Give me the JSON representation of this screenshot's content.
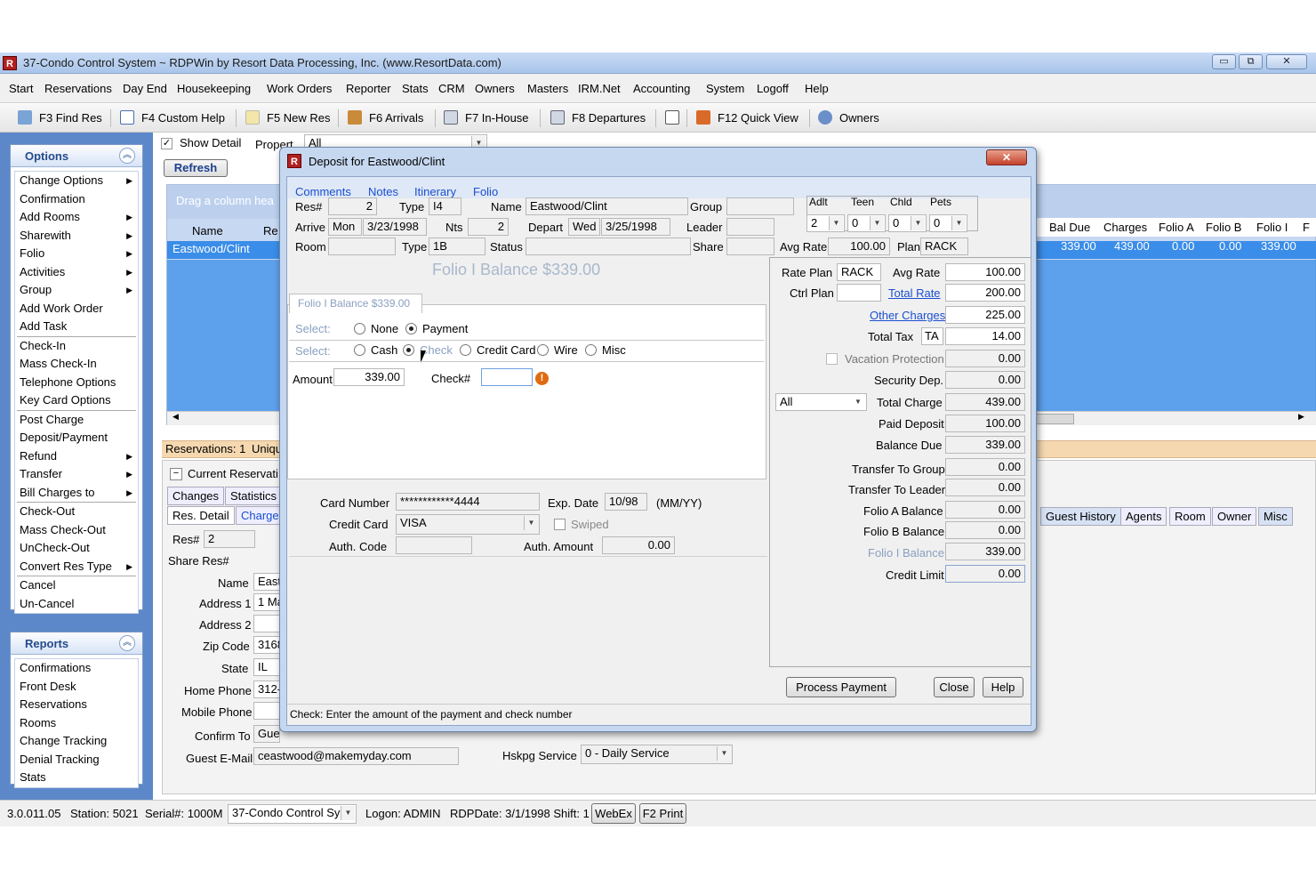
{
  "app": {
    "title": "37-Condo Control System ~ RDPWin by Resort Data Processing, Inc. (www.ResortData.com)",
    "min": "▭",
    "max": "⧉",
    "close": "✕"
  },
  "menu": [
    "Start",
    "Reservations",
    "Day End",
    "Housekeeping",
    "Work Orders",
    "Reporter",
    "Stats",
    "CRM",
    "Owners",
    "Masters",
    "IRM.Net",
    "Accounting",
    "System",
    "Logoff",
    "Help"
  ],
  "toolbar": [
    "F3 Find Res",
    "F4 Custom Help",
    "F5 New Res",
    "F6 Arrivals",
    "F7 In-House",
    "F8 Departures",
    "",
    "F12 Quick View",
    "Owners"
  ],
  "options": {
    "title": "Options",
    "items": [
      "Change Options",
      "Confirmation",
      "Add Rooms",
      "Sharewith",
      "Folio",
      "Activities",
      "Group",
      "Add Work Order",
      "Add Task",
      "Check-In",
      "Mass Check-In",
      "Telephone Options",
      "Key Card Options",
      "Post Charge",
      "Deposit/Payment",
      "Refund",
      "Transfer",
      "Bill Charges to",
      "Check-Out",
      "Mass Check-Out",
      "UnCheck-Out",
      "Convert Res Type",
      "Cancel",
      "Un-Cancel"
    ]
  },
  "reports": {
    "title": "Reports",
    "items": [
      "Confirmations",
      "Front Desk",
      "Reservations",
      "Rooms",
      "Change Tracking",
      "Denial Tracking",
      "Stats"
    ]
  },
  "main": {
    "show_detail": "Show Detail",
    "property_label": "Propert",
    "property_value": "All",
    "refresh": "Refresh",
    "drag_hint": "Drag a column hea",
    "name_col": "Name",
    "re_col": "Re",
    "row_name": "Eastwood/Clint",
    "right_cols": [
      "Bal Due",
      "Charges",
      "Folio A",
      "Folio B",
      "Folio I",
      "F"
    ],
    "right_vals": [
      "339.00",
      "439.00",
      "0.00",
      "0.00",
      "339.00"
    ],
    "reservations_count": "Reservations: 1",
    "uniq": "Uniqu",
    "current_res": "Current Reservati",
    "tabs1": [
      "Changes",
      "Statistics"
    ],
    "tabs2": [
      "Res. Detail",
      "Charge"
    ],
    "right_tabs": [
      "Guest History",
      "Agents",
      "Room",
      "Owner",
      "Misc"
    ],
    "res_label": "Res#",
    "res_value": "2",
    "share_label": "Share Res#",
    "name_label": "Name",
    "name_value": "East",
    "addr1_label": "Address 1",
    "addr1_value": "1 Ma",
    "addr2_label": "Address 2",
    "zip_label": "Zip Code",
    "zip_value": "3168",
    "state_label": "State",
    "state_value": "IL",
    "home_label": "Home Phone",
    "home_value": "312-",
    "mobile_label": "Mobile Phone",
    "confirm_label": "Confirm To",
    "confirm_value": "Guest",
    "email_label": "Guest E-Mail",
    "email_value": "ceastwood@makemyday.com",
    "hskpg_label": "Hskpg Service",
    "hskpg_value": "0 - Daily Service"
  },
  "status": {
    "version": "3.0.011.05",
    "station": "Station: 5021",
    "serial": "Serial#: 1000M",
    "system": "37-Condo Control Sy",
    "logon": "Logon: ADMIN",
    "rdpdate": "RDPDate: 3/1/1998 Shift: 1",
    "webex": "WebEx",
    "print": "F2 Print"
  },
  "dialog": {
    "title": "Deposit for Eastwood/Clint",
    "close": "✕",
    "tabs": [
      "Comments",
      "Notes",
      "Itinerary",
      "Folio"
    ],
    "res_label": "Res#",
    "res": "2",
    "type_label": "Type",
    "type": "I4",
    "name_label": "Name",
    "name": "Eastwood/Clint",
    "group_label": "Group",
    "adlt": "Adlt",
    "teen": "Teen",
    "chld": "Chld",
    "pets": "Pets",
    "adlt_v": "2",
    "teen_v": "0",
    "chld_v": "0",
    "pets_v": "0",
    "arrive_label": "Arrive",
    "arrive_day": "Mon",
    "arrive_date": "3/23/1998",
    "nts_label": "Nts",
    "nts": "2",
    "depart_label": "Depart",
    "depart_day": "Wed",
    "depart_date": "3/25/1998",
    "leader_label": "Leader",
    "room_label": "Room",
    "rtype_label": "Type",
    "rtype": "1B",
    "status_label": "Status",
    "share_label": "Share",
    "avg_rate_label": "Avg Rate",
    "avg_rate": "100.00",
    "plan_label": "Plan",
    "plan": "RACK",
    "big_balance": "Folio I Balance $339.00",
    "folio_tab": "Folio I Balance $339.00",
    "select_label": "Select:",
    "none": "None",
    "payment": "Payment",
    "cash": "Cash",
    "check": "Check",
    "credit_card": "Credit Card",
    "wire": "Wire",
    "misc": "Misc",
    "amount_label": "Amount",
    "amount": "339.00",
    "checkno_label": "Check#",
    "card_number_label": "Card Number",
    "card_number": "************4444",
    "exp_label": "Exp. Date",
    "exp": "10/98",
    "exp_fmt": "(MM/YY)",
    "cc_label": "Credit Card",
    "cc": "VISA",
    "swiped": "Swiped",
    "auth_code_label": "Auth. Code",
    "auth_amount_label": "Auth. Amount",
    "auth_amount": "0.00",
    "rate_plan_label": "Rate Plan",
    "rate_plan": "RACK",
    "ctrl_plan_label": "Ctrl Plan",
    "r_avg_rate_label": "Avg Rate",
    "r_avg_rate": "100.00",
    "total_rate": "Total Rate",
    "total_rate_v": "200.00",
    "other_charges": "Other Charges",
    "other_charges_v": "225.00",
    "total_tax_label": "Total Tax",
    "total_tax_code": "TA",
    "total_tax": "14.00",
    "vac_prot": "Vacation Protection",
    "vac_prot_v": "0.00",
    "sec_dep_label": "Security Dep.",
    "sec_dep": "0.00",
    "filter": "All",
    "total_charge_label": "Total Charge",
    "total_charge": "439.00",
    "paid_dep_label": "Paid Deposit",
    "paid_dep": "100.00",
    "bal_due_label": "Balance Due",
    "bal_due": "339.00",
    "tr_group_label": "Transfer To Group",
    "tr_group": "0.00",
    "tr_leader_label": "Transfer To Leader",
    "tr_leader": "0.00",
    "fa_label": "Folio A Balance",
    "fa": "0.00",
    "fb_label": "Folio B Balance",
    "fb": "0.00",
    "fi_label": "Folio I Balance",
    "fi": "339.00",
    "credit_limit_label": "Credit Limit",
    "credit_limit": "0.00",
    "process": "Process Payment",
    "close_btn": "Close",
    "help": "Help",
    "hint": "Check: Enter the amount of the payment and check number"
  }
}
